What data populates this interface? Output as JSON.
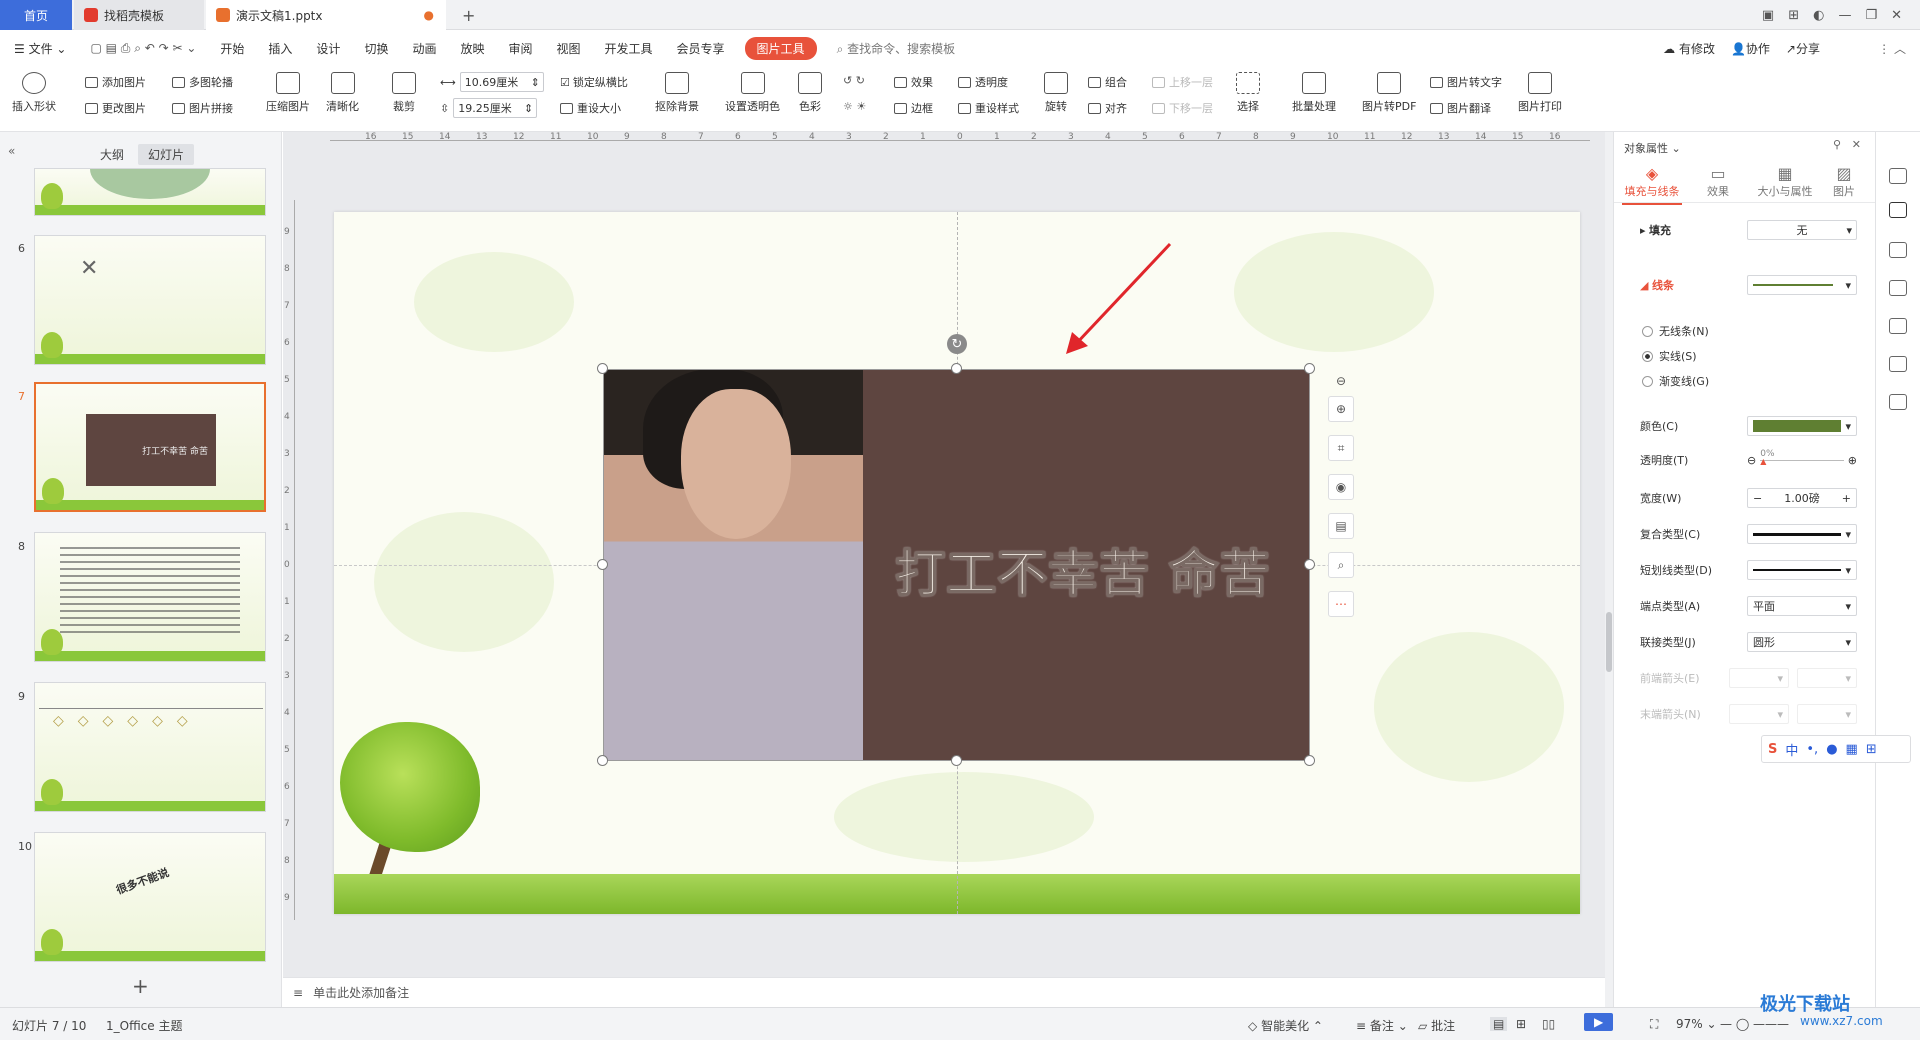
{
  "titlebar": {
    "home_tab": "首页",
    "template_tab": "找稻壳模板",
    "doc_tab": "演示文稿1.pptx",
    "new_tab": "+"
  },
  "menubar": {
    "file": "文件",
    "items": [
      "开始",
      "插入",
      "设计",
      "切换",
      "动画",
      "放映",
      "审阅",
      "视图",
      "开发工具",
      "会员专享"
    ],
    "picture_tools": "图片工具",
    "search_placeholder": "查找命令、搜索模板",
    "modified": "有修改",
    "collaborate": "协作",
    "share": "分享"
  },
  "ribbon": {
    "insert_shape": "插入形状",
    "add_picture": "添加图片",
    "change_picture": "更改图片",
    "multi_carousel": "多图轮播",
    "picture_splice": "图片拼接",
    "compress": "压缩图片",
    "clarify": "清晰化",
    "crop": "裁剪",
    "width": "10.69厘米",
    "height": "19.25厘米",
    "lock_ratio": "锁定纵横比",
    "reset_size": "重设大小",
    "remove_bg": "抠除背景",
    "set_transparent": "设置透明色",
    "color": "色彩",
    "effects": "效果",
    "border": "边框",
    "transparency": "透明度",
    "reset_style": "重设样式",
    "rotate": "旋转",
    "group": "组合",
    "align": "对齐",
    "move_up": "上移一层",
    "move_down": "下移一层",
    "select": "选择",
    "batch": "批量处理",
    "to_pdf": "图片转PDF",
    "to_text": "图片转文字",
    "translate": "图片翻译",
    "print": "图片打印"
  },
  "leftpanel": {
    "tab_outline": "大纲",
    "tab_slides": "幻灯片",
    "slide_numbers": [
      "6",
      "7",
      "8",
      "9",
      "10"
    ],
    "thumb7_caption": "打工不幸苦 命苦",
    "thumb10_caption": "很多不能说",
    "add": "+"
  },
  "slide": {
    "caption": "打工不幸苦 命苦"
  },
  "notes": {
    "placeholder": "单击此处添加备注"
  },
  "rightpanel": {
    "title": "对象属性",
    "tabs": [
      "填充与线条",
      "效果",
      "大小与属性",
      "图片"
    ],
    "fill_label": "填充",
    "fill_value": "无",
    "line_label": "线条",
    "radio_none": "无线条(N)",
    "radio_solid": "实线(S)",
    "radio_gradient": "渐变线(G)",
    "color_label": "颜色(C)",
    "transparency_label": "透明度(T)",
    "transparency_value": "0%",
    "width_label": "宽度(W)",
    "width_value": "1.00磅",
    "compound_label": "复合类型(C)",
    "dash_label": "短划线类型(D)",
    "cap_label": "端点类型(A)",
    "cap_value": "平面",
    "join_label": "联接类型(J)",
    "join_value": "圆形",
    "begin_arrow_label": "前端箭头(E)",
    "end_arrow_label": "末端箭头(N)",
    "line_color": "#5f7f32"
  },
  "statusbar": {
    "slide_info": "幻灯片 7 / 10",
    "theme": "1_Office 主题",
    "smart_beautify": "智能美化",
    "notes": "备注",
    "comment": "批注",
    "zoom": "97%"
  },
  "ime": {
    "lang": "中"
  },
  "watermark": {
    "site_name": "极光下载站",
    "url": "www.xz7.com"
  },
  "colors": {
    "accent_tab": "#3d6ddb",
    "picture_tools": "#e8523b",
    "selected_thumb": "#e8702e",
    "picture_bg": "#5e4540"
  }
}
